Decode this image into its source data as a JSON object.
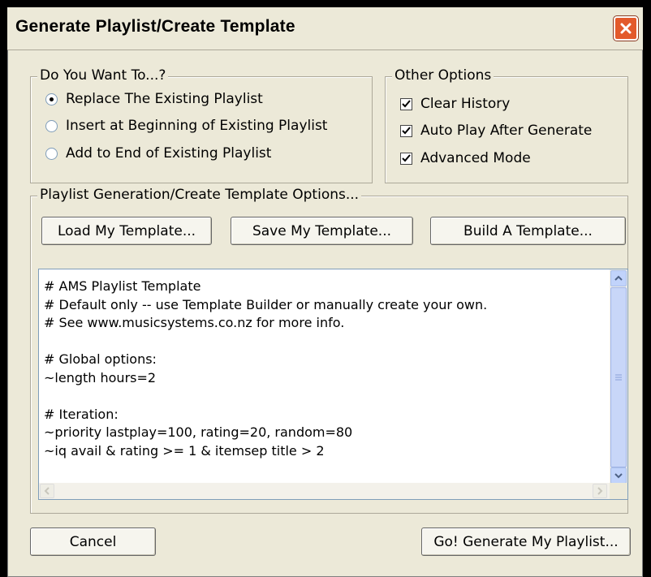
{
  "window": {
    "title": "Generate Playlist/Create Template"
  },
  "mode_group": {
    "legend": "Do You Want To...?",
    "options": [
      {
        "label": "Replace The Existing Playlist",
        "selected": true
      },
      {
        "label": "Insert at Beginning of Existing Playlist",
        "selected": false
      },
      {
        "label": "Add to End of Existing Playlist",
        "selected": false
      }
    ]
  },
  "other_options": {
    "legend": "Other Options",
    "items": [
      {
        "label": "Clear History",
        "checked": true
      },
      {
        "label": "Auto Play After Generate",
        "checked": true
      },
      {
        "label": "Advanced Mode",
        "checked": true
      }
    ]
  },
  "template_group": {
    "legend": "Playlist Generation/Create Template Options...",
    "buttons": {
      "load": "Load My Template...",
      "save": "Save My Template...",
      "build": "Build A Template..."
    }
  },
  "editor": {
    "lines": [
      "# AMS Playlist Template",
      "# Default only -- use Template Builder or manually create your own.",
      "# See www.musicsystems.co.nz for more info.",
      "",
      "# Global options:",
      "~length hours=2",
      "",
      "# Iteration:",
      "~priority lastplay=100, rating=20, random=80",
      "~iq avail & rating >= 1 & itemsep title > 2"
    ]
  },
  "footer": {
    "cancel": "Cancel",
    "generate": "Go! Generate My Playlist..."
  }
}
